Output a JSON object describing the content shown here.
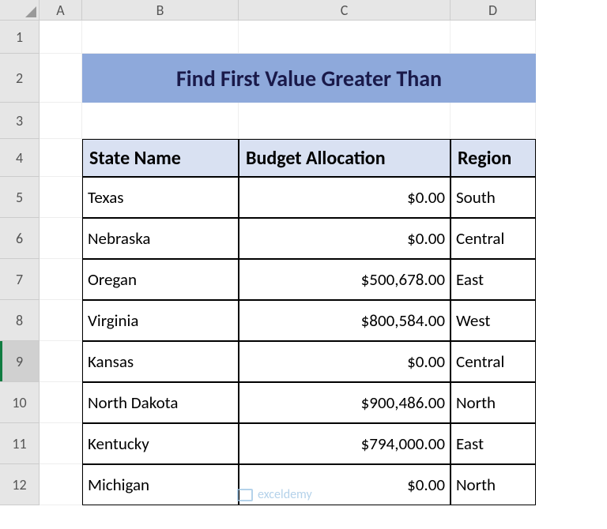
{
  "columns": [
    "A",
    "B",
    "C",
    "D"
  ],
  "rows": [
    "1",
    "2",
    "3",
    "4",
    "5",
    "6",
    "7",
    "8",
    "9",
    "10",
    "11",
    "12"
  ],
  "title": "Find First Value Greater Than",
  "headers": {
    "col1": "State Name",
    "col2": "Budget Allocation",
    "col3": "Region"
  },
  "data": [
    {
      "state": "Texas",
      "budget": "$0.00",
      "region": "South"
    },
    {
      "state": "Nebraska",
      "budget": "$0.00",
      "region": "Central"
    },
    {
      "state": "Oregan",
      "budget": "$500,678.00",
      "region": "East"
    },
    {
      "state": "Virginia",
      "budget": "$800,584.00",
      "region": "West"
    },
    {
      "state": "Kansas",
      "budget": "$0.00",
      "region": "Central"
    },
    {
      "state": "North Dakota",
      "budget": "$900,486.00",
      "region": "North"
    },
    {
      "state": "Kentucky",
      "budget": "$794,000.00",
      "region": "East"
    },
    {
      "state": "Michigan",
      "budget": "$0.00",
      "region": "North"
    }
  ],
  "watermark": "exceldemy",
  "selected_row": 9
}
